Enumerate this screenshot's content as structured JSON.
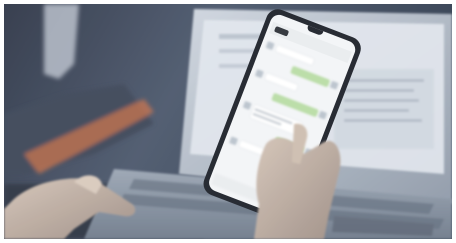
{
  "scene": {
    "subject": "smartphone-messaging-app",
    "colors": {
      "bg_dark": "#1a2230",
      "bg_mid": "#46536a",
      "laptop_frame": "#c9d1dc",
      "laptop_screen": "#e3e8ef",
      "phone_body": "#1b1f28",
      "phone_screen": "#f3f5f7",
      "bubble_green": "#b8dca4",
      "bubble_white": "#ffffff",
      "skin": "#c6b5a6",
      "accent_orange": "#c86f46"
    }
  },
  "icons": {
    "avatar": "avatar-icon"
  }
}
